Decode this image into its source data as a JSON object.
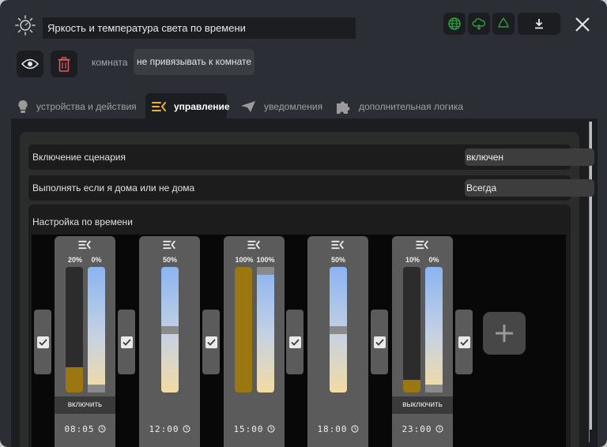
{
  "header": {
    "title": "Яркость и температура света по времени",
    "icons": [
      "sun-icon",
      "globe-icon",
      "cloud-sync-icon",
      "recycle-icon",
      "download-icon",
      "close-icon"
    ],
    "accent_green": "#2ea043"
  },
  "room": {
    "label": "комната",
    "value": "не привязывать к комнате"
  },
  "tabs": [
    {
      "label": "устройства и действия",
      "icon": "bulb-icon"
    },
    {
      "label": "управление",
      "icon": "control-icon",
      "active": true
    },
    {
      "label": "уведомления",
      "icon": "paper-plane-icon"
    },
    {
      "label": "дополнительная логика",
      "icon": "puzzle-icon"
    }
  ],
  "settings": {
    "enable_label": "Включение сценария",
    "enable_value": "включен",
    "home_label": "Выполнять если я дома или не дома",
    "home_value": "Всегда"
  },
  "schedule": {
    "title": "Настройка по времени",
    "slots": [
      {
        "time": "08:05",
        "brightness_label": "20%",
        "temp_label": "0%",
        "brightness": 0.2,
        "temperature": 0.0,
        "action": "включить",
        "enabled": true
      },
      {
        "time": "12:00",
        "temp_label": "50%",
        "temperature": 0.5,
        "enabled": true
      },
      {
        "time": "15:00",
        "brightness_label": "100%",
        "temp_label": "100%",
        "brightness": 1.0,
        "temperature": 1.0,
        "enabled": true
      },
      {
        "time": "18:00",
        "temp_label": "50%",
        "temperature": 0.5,
        "enabled": true
      },
      {
        "time": "23:00",
        "brightness_label": "10%",
        "temp_label": "0%",
        "brightness": 0.1,
        "temperature": 0.0,
        "action": "выключить",
        "enabled": true
      }
    ],
    "brightness_color": "#9a7710"
  }
}
